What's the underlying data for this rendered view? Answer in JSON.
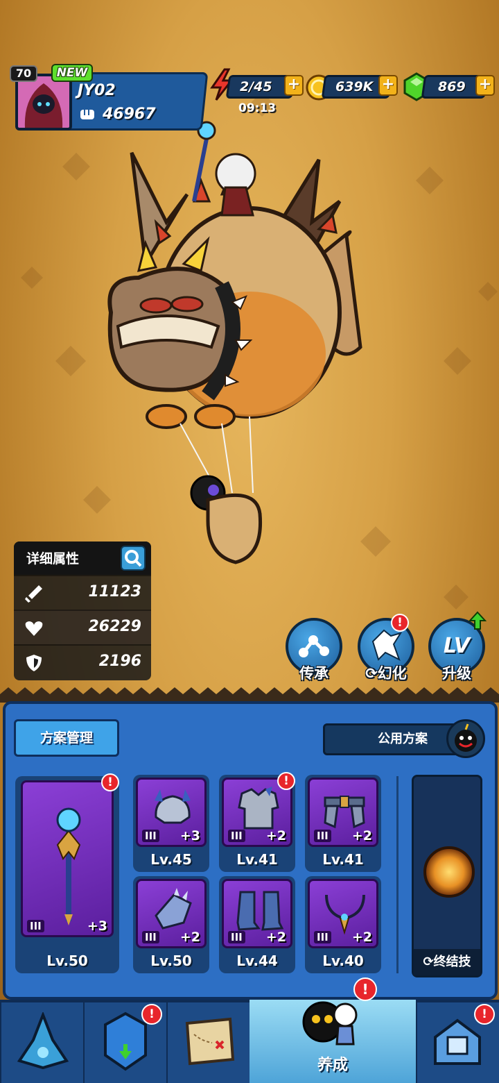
{
  "player": {
    "level": "70",
    "new_badge": "NEW",
    "name": "JY02",
    "power": "46967"
  },
  "resources": {
    "energy": "2/45",
    "energy_timer": "09:13",
    "gold": "639K",
    "gems": "869",
    "plus": "+"
  },
  "stats": {
    "title": "详细属性",
    "attack": "11123",
    "hp": "26229",
    "defense": "2196"
  },
  "actions": {
    "inherit": "传承",
    "transform": "幻化",
    "upgrade": "升级",
    "upgrade_icon": "LV"
  },
  "equipment": {
    "plan_button": "方案管理",
    "shared_plan": "公用方案",
    "main": {
      "tier": "III",
      "plus": "+3",
      "level": "Lv.50"
    },
    "slots": [
      {
        "tier": "III",
        "plus": "+3",
        "level": "Lv.45"
      },
      {
        "tier": "III",
        "plus": "+2",
        "level": "Lv.41"
      },
      {
        "tier": "III",
        "plus": "+2",
        "level": "Lv.41"
      },
      {
        "tier": "III",
        "plus": "+2",
        "level": "Lv.50"
      },
      {
        "tier": "III",
        "plus": "+2",
        "level": "Lv.44"
      },
      {
        "tier": "III",
        "plus": "+2",
        "level": "Lv.40"
      }
    ],
    "ultimate_label": "终结技"
  },
  "nav": {
    "active_label": "养成"
  },
  "colors": {
    "panel_blue": "#2d6fc4",
    "card_purple": "#8b3fd6",
    "alert_red": "#e8252b",
    "gold": "#f2b21a"
  }
}
